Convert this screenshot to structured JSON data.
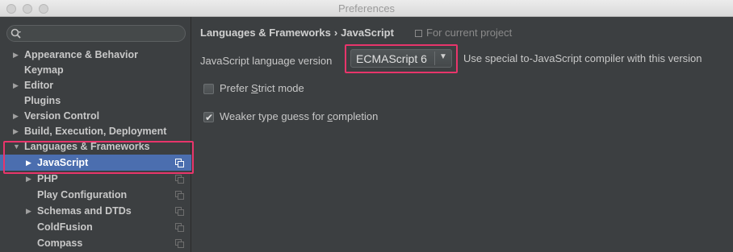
{
  "window": {
    "title": "Preferences"
  },
  "search": {
    "placeholder": ""
  },
  "sidebar": {
    "items": [
      {
        "label": "Appearance & Behavior",
        "has_arrow": true,
        "arrow": "▶"
      },
      {
        "label": "Keymap",
        "has_arrow": false
      },
      {
        "label": "Editor",
        "has_arrow": true,
        "arrow": "▶"
      },
      {
        "label": "Plugins",
        "has_arrow": false
      },
      {
        "label": "Version Control",
        "has_arrow": true,
        "arrow": "▶"
      },
      {
        "label": "Build, Execution, Deployment",
        "has_arrow": true,
        "arrow": "▶"
      },
      {
        "label": "Languages & Frameworks",
        "has_arrow": true,
        "arrow": "▼",
        "expanded": true
      }
    ],
    "children": [
      {
        "label": "JavaScript",
        "arrow": "▶",
        "selected": true
      },
      {
        "label": "PHP",
        "arrow": "▶"
      },
      {
        "label": "Play Configuration",
        "arrow": ""
      },
      {
        "label": "Schemas and DTDs",
        "arrow": "▶"
      },
      {
        "label": "ColdFusion",
        "arrow": ""
      },
      {
        "label": "Compass",
        "arrow": ""
      }
    ]
  },
  "main": {
    "breadcrumb": {
      "parent": "Languages & Frameworks",
      "separator": "›",
      "current": "JavaScript"
    },
    "scope_label": "For current project",
    "version_label": "JavaScript language version",
    "version_value": "ECMAScript 6",
    "version_hint": "Use special to-JavaScript compiler with this version",
    "strict_mode": {
      "prefix": "Prefer ",
      "mnemonic": "S",
      "suffix": "trict mode",
      "checked": false
    },
    "weaker_type": {
      "prefix": "Weaker type guess for ",
      "mnemonic": "c",
      "suffix": "ompletion",
      "checked": true
    }
  },
  "colors": {
    "selection": "#4b6eaf",
    "highlight": "#e8356b",
    "background": "#3c3f41"
  }
}
